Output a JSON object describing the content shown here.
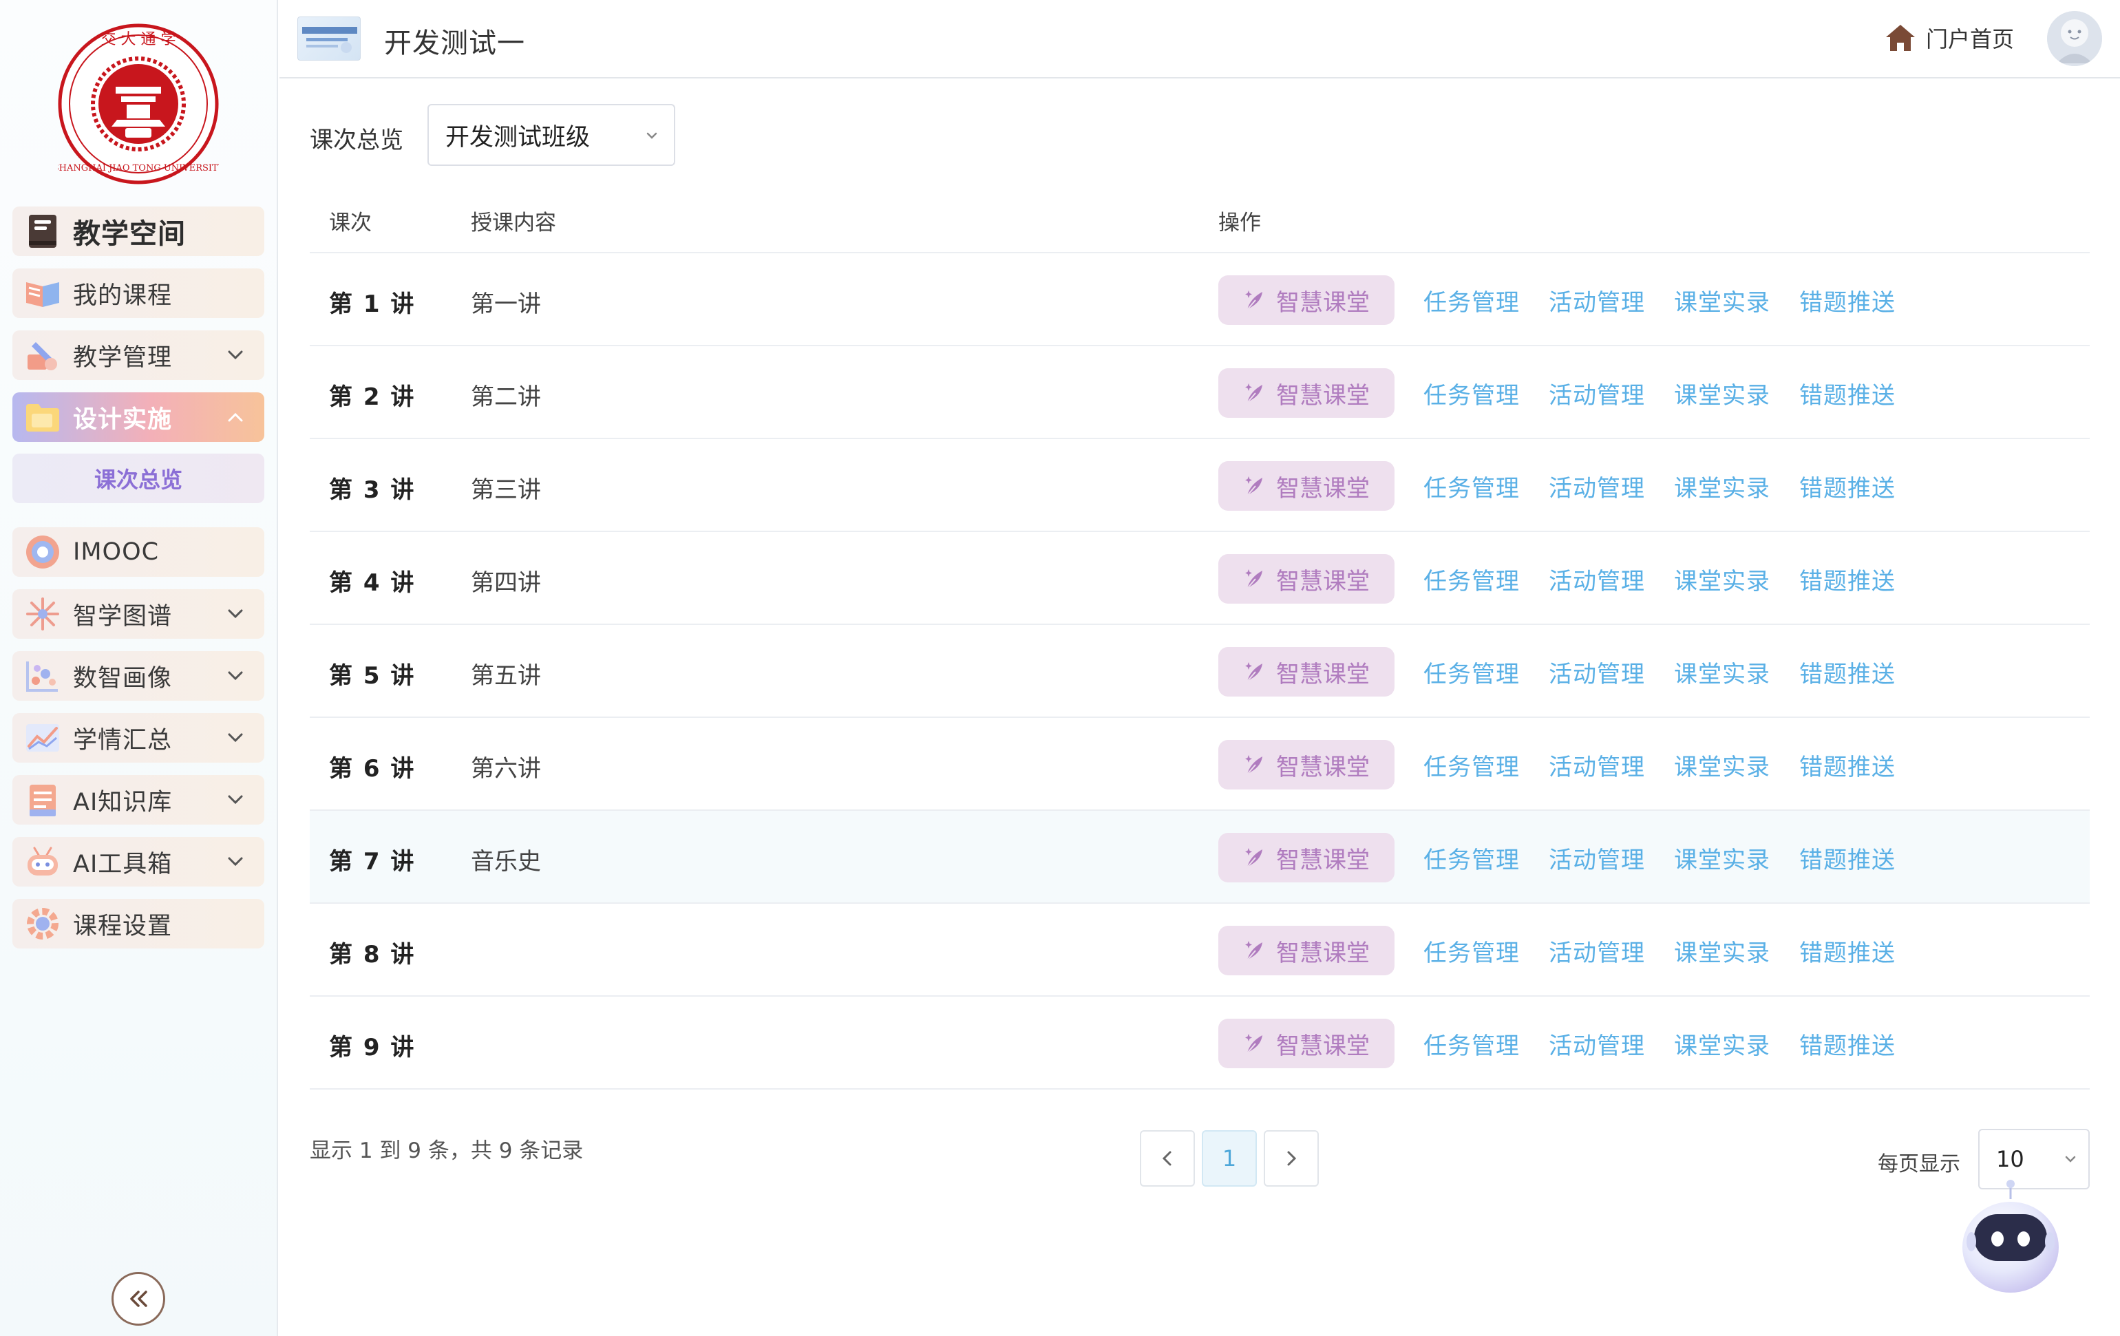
{
  "sidebar": {
    "items": [
      {
        "label": "教学空间"
      },
      {
        "label": "我的课程"
      },
      {
        "label": "教学管理"
      },
      {
        "label": "设计实施"
      },
      {
        "label": "IMOOC"
      },
      {
        "label": "智学图谱"
      },
      {
        "label": "数智画像"
      },
      {
        "label": "学情汇总"
      },
      {
        "label": "AI知识库"
      },
      {
        "label": "AI工具箱"
      },
      {
        "label": "课程设置"
      }
    ],
    "sub_item": "课次总览"
  },
  "header": {
    "course_title": "开发测试一",
    "portal_label": "门户首页"
  },
  "filter": {
    "label": "课次总览",
    "selected_class": "开发测试班级"
  },
  "table": {
    "columns": [
      "课次",
      "授课内容",
      "操作"
    ],
    "rows": [
      {
        "lesson": "第 1 讲",
        "content": "第一讲"
      },
      {
        "lesson": "第 2 讲",
        "content": "第二讲"
      },
      {
        "lesson": "第 3 讲",
        "content": "第三讲"
      },
      {
        "lesson": "第 4 讲",
        "content": "第四讲"
      },
      {
        "lesson": "第 5 讲",
        "content": "第五讲"
      },
      {
        "lesson": "第 6 讲",
        "content": "第六讲"
      },
      {
        "lesson": "第 7 讲",
        "content": "音乐史"
      },
      {
        "lesson": "第 8 讲",
        "content": ""
      },
      {
        "lesson": "第 9 讲",
        "content": ""
      }
    ],
    "actions": {
      "smart": "智慧课堂",
      "task": "任务管理",
      "activity": "活动管理",
      "record": "课堂实录",
      "wrong": "错题推送"
    }
  },
  "pagination": {
    "record_info": "显示 1 到 9 条，共 9 条记录",
    "current_page": "1",
    "per_page_label": "每页显示",
    "per_page_value": "10"
  },
  "colors": {
    "accent_link": "#5ab0e6",
    "smart_button_bg": "#eee0ee",
    "smart_button_text": "#b07cbf",
    "active_nav_gradient": [
      "#b7b8ef",
      "#f3b0b8",
      "#f7c39a"
    ]
  }
}
